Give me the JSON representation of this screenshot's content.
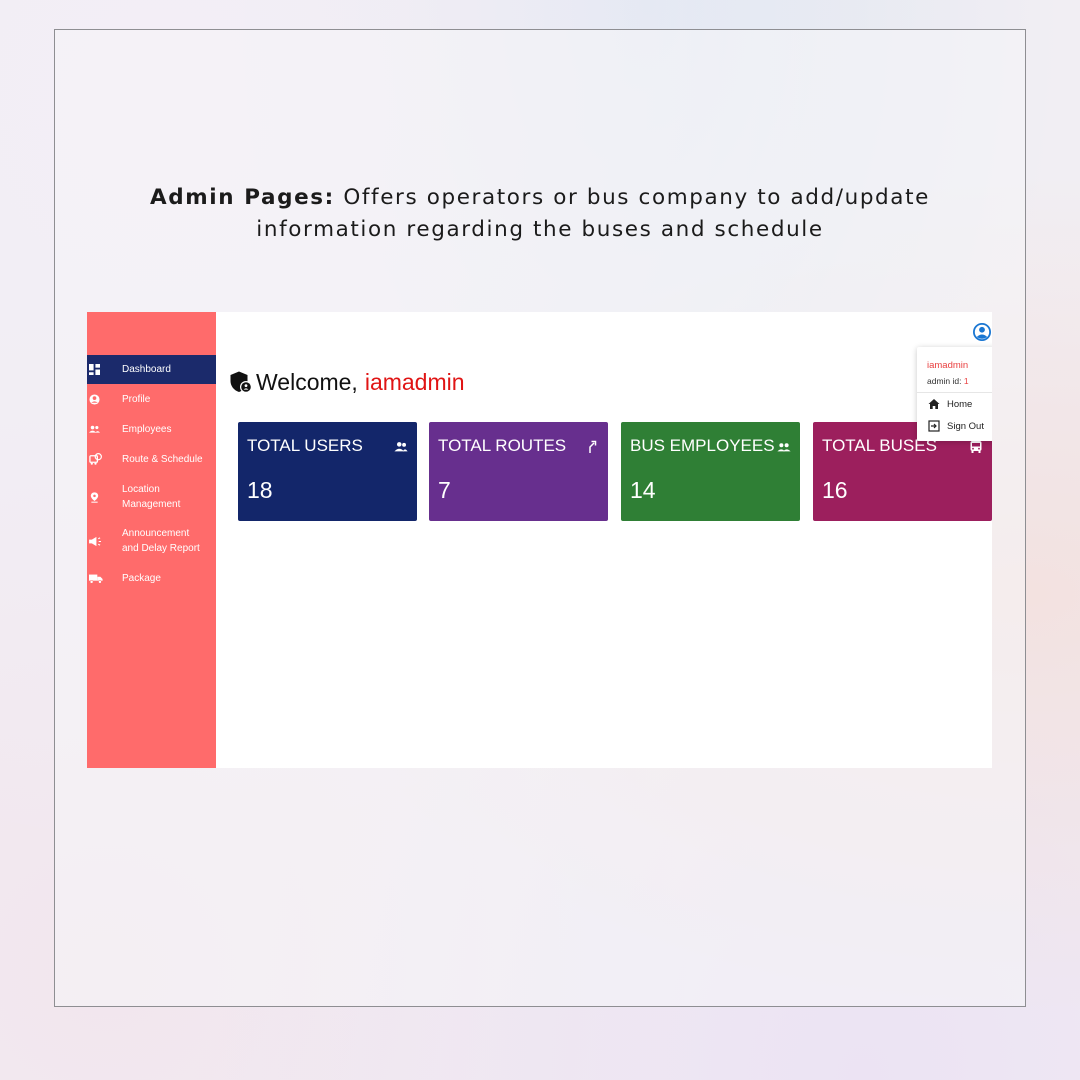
{
  "caption": {
    "bold": "Admin Pages:",
    "line1": "Offers operators or bus company to add/update",
    "line2": "information regarding the buses and schedule"
  },
  "sidebar": {
    "items": [
      {
        "label": "Dashboard",
        "icon": "dashboard-icon",
        "active": true
      },
      {
        "label": "Profile",
        "icon": "profile-icon"
      },
      {
        "label": "Employees",
        "icon": "employees-icon"
      },
      {
        "label": "Route & Schedule",
        "icon": "bus-route-icon"
      },
      {
        "label_line1": "Location",
        "label_line2": "Management",
        "icon": "location-pin-icon"
      },
      {
        "label_line1": "Announcement",
        "label_line2": "and Delay Report",
        "icon": "megaphone-icon"
      },
      {
        "label": "Package",
        "icon": "truck-icon"
      }
    ]
  },
  "header": {
    "welcome": "Welcome,",
    "username": "iamadmin"
  },
  "cards": [
    {
      "title": "TOTAL USERS",
      "value": "18",
      "color": "#13266a",
      "icon": "users-icon"
    },
    {
      "title": "TOTAL ROUTES",
      "value": "7",
      "color": "#672f8e",
      "icon": "route-icon"
    },
    {
      "title": "BUS EMPLOYEES",
      "value": "14",
      "color": "#2f7f35",
      "icon": "people-icon"
    },
    {
      "title": "TOTAL BUSES",
      "value": "16",
      "color": "#9c1f5d",
      "icon": "bus-icon"
    }
  ],
  "dropdown": {
    "username": "iamadmin",
    "admin_id_label": "admin id:",
    "admin_id": "1",
    "home": "Home",
    "sign_out": "Sign Out"
  },
  "colors": {
    "sidebar_bg": "#ff6b6b",
    "sidebar_active": "#1b2a6b",
    "accent_red": "#e01414",
    "user_icon_blue": "#1976d2"
  }
}
